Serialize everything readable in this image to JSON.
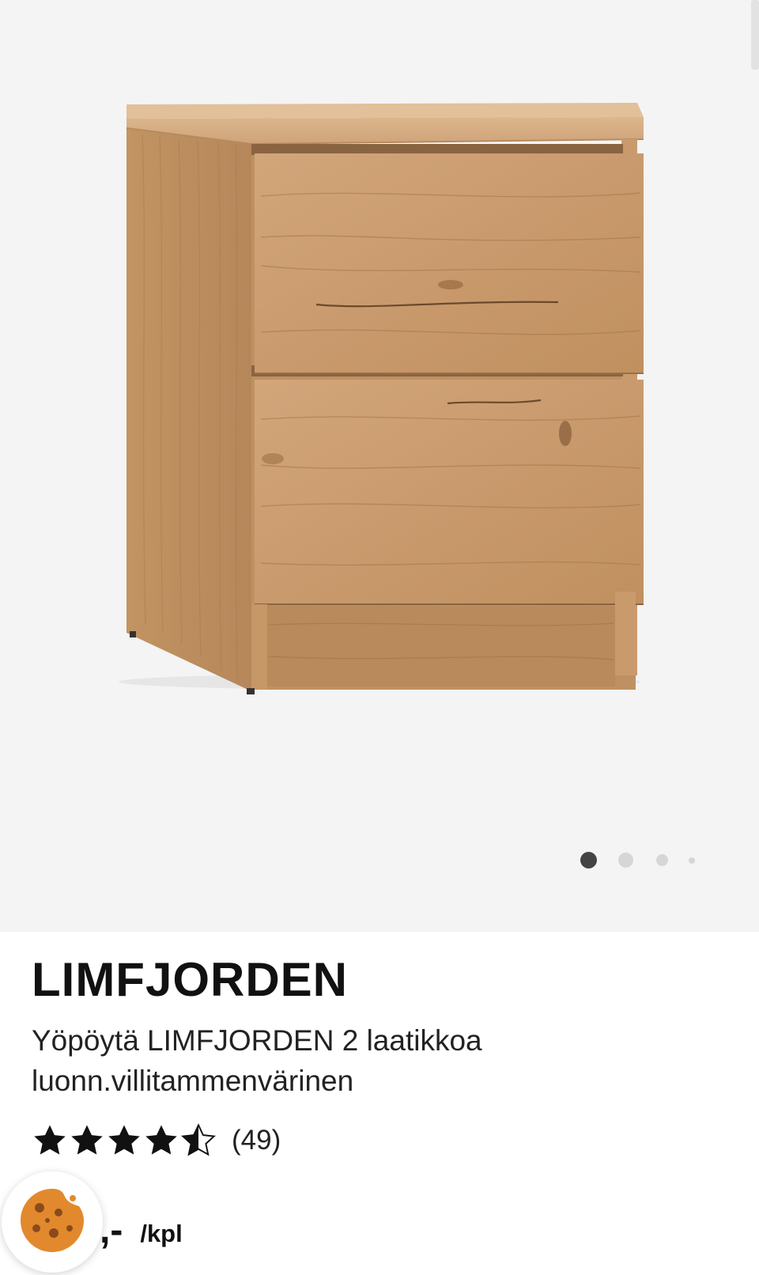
{
  "product": {
    "brand": "LIMFJORDEN",
    "description": "Yöpöytä LIMFJORDEN 2 laatikkoa luonn.villitammenvärinen",
    "rating": {
      "value": 4.5,
      "max": 5,
      "count_text": "(49)"
    },
    "price": {
      "value_visible": ",-",
      "unit": "/kpl"
    }
  },
  "gallery": {
    "image_icon": "nightstand-photo",
    "slide_count": 4,
    "active_slide": 1
  },
  "cookie_button": {
    "icon": "cookie-icon"
  },
  "colors": {
    "gallery_background": "#f4f4f4",
    "active_dot": "#444444",
    "inactive_dot": "#d6d6d6",
    "wood": "#c99a6c",
    "cookie": "#e2892e"
  }
}
